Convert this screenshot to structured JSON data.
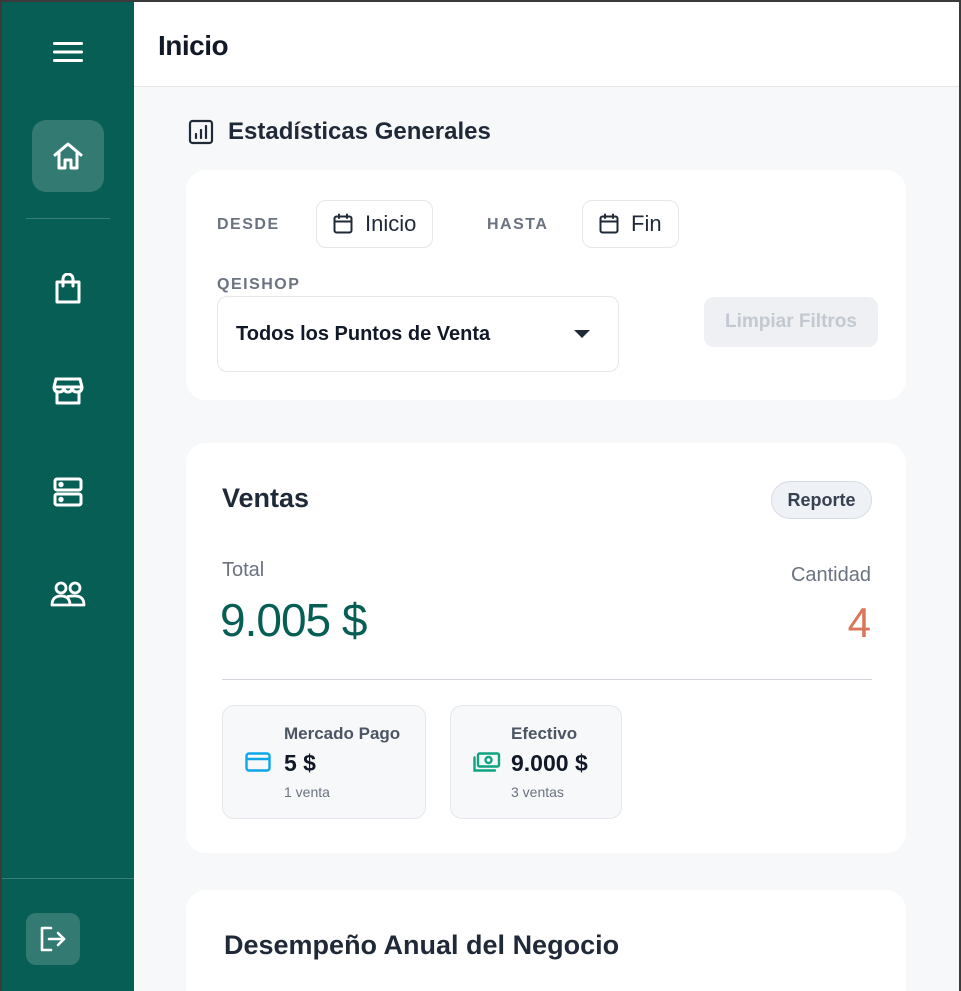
{
  "header": {
    "title": "Inicio"
  },
  "stats": {
    "title": "Estadísticas Generales"
  },
  "filters": {
    "desde_label": "DESDE",
    "desde_value": "Inicio",
    "hasta_label": "HASTA",
    "hasta_value": "Fin",
    "shop_label": "QEISHOP",
    "shop_selected": "Todos los Puntos de Venta",
    "clear_label": "Limpiar Filtros"
  },
  "sales": {
    "title": "Ventas",
    "report_label": "Reporte",
    "total_label": "Total",
    "total_value": "9.005 $",
    "qty_label": "Cantidad",
    "qty_value": "4",
    "methods": [
      {
        "name": "Mercado Pago",
        "amount": "5 $",
        "count": "1 venta"
      },
      {
        "name": "Efectivo",
        "amount": "9.000 $",
        "count": "3 ventas"
      }
    ]
  },
  "annual": {
    "title": "Desempeño Anual del Negocio"
  },
  "colors": {
    "sidebar": "#075e54",
    "accent": "#075e54",
    "quantity": "#d9765b",
    "mercadopago_icon": "#0ea5e9",
    "cash_icon": "#10a37f"
  },
  "icons": [
    "menu-icon",
    "home-icon",
    "shopping-bag-icon",
    "store-icon",
    "server-icon",
    "users-icon",
    "logout-icon",
    "chart-icon",
    "calendar-icon",
    "credit-card-icon",
    "cash-icon"
  ]
}
